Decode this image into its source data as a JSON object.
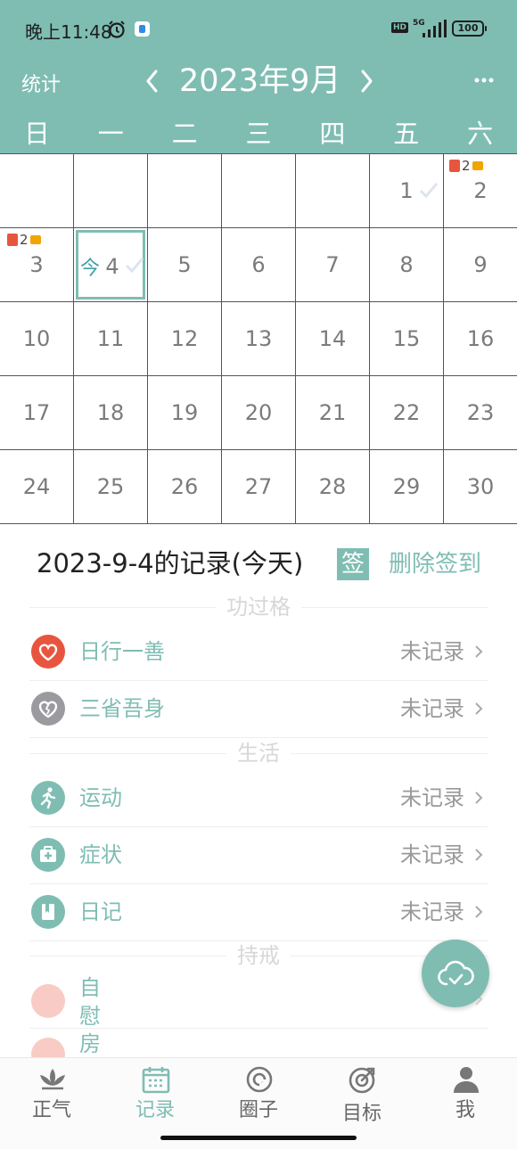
{
  "status_bar": {
    "time": "晚上11:48",
    "signal_label": "5G",
    "hd_label": "HD",
    "battery": "100"
  },
  "header": {
    "stats_label": "统计",
    "month_title": "2023年9月"
  },
  "weekdays": [
    "日",
    "一",
    "二",
    "三",
    "四",
    "五",
    "六"
  ],
  "calendar": {
    "today_label": "今",
    "day1_num": "1",
    "day2_num": "2",
    "day2_count": "2",
    "day3_num": "3",
    "day3_count": "2",
    "day4_num": "4",
    "rest": [
      "5",
      "6",
      "7",
      "8",
      "9",
      "10",
      "11",
      "12",
      "13",
      "14",
      "15",
      "16",
      "17",
      "18",
      "19",
      "20",
      "21",
      "22",
      "23",
      "24",
      "25",
      "26",
      "27",
      "28",
      "29",
      "30"
    ]
  },
  "record": {
    "title": "2023-9-4的记录(今天)",
    "sign_label": "签",
    "delete_label": "删除签到",
    "sections": {
      "merit": "功过格",
      "life": "生活",
      "precepts": "持戒"
    },
    "items": {
      "good_deed": "日行一善",
      "reflect": "三省吾身",
      "exercise": "运动",
      "symptom": "症状",
      "diary": "日记",
      "self_comfort": "自慰",
      "sex": "房"
    },
    "status_label": "未记录",
    "colors": {
      "accent": "#7fbdb3",
      "heart": "#e8553f",
      "grey": "#9a9a9f"
    }
  },
  "nav": {
    "zhengqi": "正气",
    "record": "记录",
    "circle": "圈子",
    "goal": "目标",
    "me": "我"
  }
}
